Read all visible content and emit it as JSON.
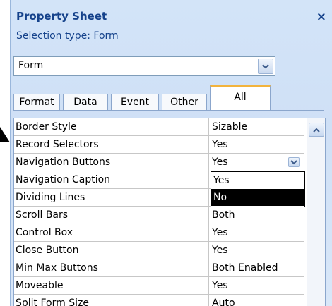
{
  "pane": {
    "title": "Property Sheet",
    "close_glyph": "×",
    "selection_type": "Selection type:  Form"
  },
  "selector": {
    "value": "Form"
  },
  "tabs": [
    {
      "label": "Format"
    },
    {
      "label": "Data"
    },
    {
      "label": "Event"
    },
    {
      "label": "Other"
    },
    {
      "label": "All"
    }
  ],
  "active_tab": "All",
  "properties": [
    {
      "name": "Border Style",
      "value": "Sizable"
    },
    {
      "name": "Record Selectors",
      "value": "Yes"
    },
    {
      "name": "Navigation Buttons",
      "value": "Yes"
    },
    {
      "name": "Navigation Caption",
      "value": ""
    },
    {
      "name": "Dividing Lines",
      "value": ""
    },
    {
      "name": "Scroll Bars",
      "value": "Both"
    },
    {
      "name": "Control Box",
      "value": "Yes"
    },
    {
      "name": "Close Button",
      "value": "Yes"
    },
    {
      "name": "Min Max Buttons",
      "value": "Both Enabled"
    },
    {
      "name": "Moveable",
      "value": "Yes"
    },
    {
      "name": "Split Form Size",
      "value": "Auto"
    }
  ],
  "dropdown": {
    "options": [
      "Yes",
      "No"
    ],
    "selected": "No"
  },
  "icons": {
    "combo_arrow": "chevron-down-icon",
    "cell_arrow": "chevron-down-icon",
    "scroll_up": "chevron-up-icon",
    "pointer": "arrow-pointer-icon"
  }
}
